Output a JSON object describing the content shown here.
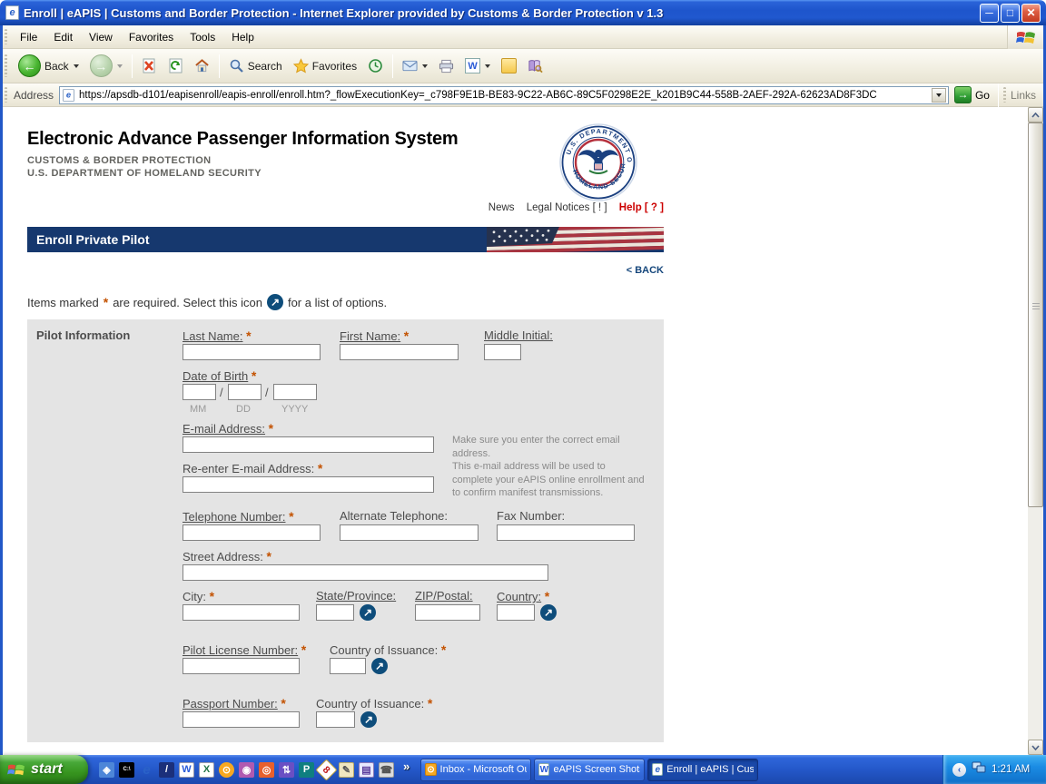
{
  "window": {
    "title": "Enroll | eAPIS | Customs and Border Protection - Internet Explorer provided by Customs & Border Protection v 1.3"
  },
  "menubar": {
    "items": [
      "File",
      "Edit",
      "View",
      "Favorites",
      "Tools",
      "Help"
    ]
  },
  "toolbar": {
    "back": "Back",
    "search": "Search",
    "favorites": "Favorites"
  },
  "addressbar": {
    "label": "Address",
    "url": "https://apsdb-d101/eapisenroll/eapis-enroll/enroll.htm?_flowExecutionKey=_c798F9E1B-BE83-9C22-AB6C-89C5F0298E2E_k201B9C44-558B-2AEF-292A-62623AD8F3DC",
    "go": "Go",
    "links": "Links"
  },
  "header": {
    "title": "Electronic Advance Passenger Information System",
    "line1": "CUSTOMS & BORDER PROTECTION",
    "line2": "U.S. DEPARTMENT OF HOMELAND SECURITY"
  },
  "utility": {
    "news": "News",
    "legal": "Legal Notices [ ! ]",
    "help": "Help [ ? ]"
  },
  "banner": {
    "title": "Enroll Private Pilot",
    "back": "< BACK"
  },
  "note": {
    "pre": "Items marked",
    "mid": "are required. Select this icon",
    "post": "for a list of options."
  },
  "icons": {
    "option_arrow": "↗"
  },
  "colors": {
    "banner_navy": "#16386e",
    "help_red": "#cc0000",
    "asterisk_orange": "#c35200",
    "back_link_blue": "#16477c"
  },
  "form": {
    "req": "*",
    "section": "Pilot Information",
    "last_name": "Last Name:",
    "first_name": "First Name:",
    "middle_initial": "Middle Initial:",
    "dob": "Date of Birth",
    "mm": "MM",
    "dd": "DD",
    "yyyy": "YYYY",
    "slash": "/",
    "email": "E-mail Address:",
    "email_note1": "Make sure you enter the correct email address.",
    "email_note2": "This e-mail address will be used to complete your eAPIS online enrollment and to confirm manifest transmissions.",
    "reenter_email": "Re-enter E-mail Address:",
    "telephone": "Telephone Number:",
    "alt_telephone": "Alternate Telephone:",
    "fax": "Fax Number:",
    "street": "Street Address:",
    "city": "City:",
    "state": "State/Province:",
    "zip": "ZIP/Postal:",
    "country": "Country:",
    "pilot_license": "Pilot License Number:",
    "license_country": "Country of Issuance:",
    "passport": "Passport Number:",
    "passport_country": "Country of Issuance:"
  },
  "taskbar": {
    "start": "start",
    "more": "»",
    "quick_launch": [
      {
        "name": "app",
        "glyph": "◈"
      },
      {
        "name": "command-prompt",
        "glyph": "C:\\"
      },
      {
        "name": "internet-explorer",
        "glyph": "e"
      },
      {
        "name": "slash-app",
        "glyph": "/"
      },
      {
        "name": "word",
        "glyph": "W"
      },
      {
        "name": "excel",
        "glyph": "X"
      },
      {
        "name": "clock-app",
        "glyph": "⊙"
      },
      {
        "name": "key-app",
        "glyph": "◉"
      },
      {
        "name": "orange-app",
        "glyph": "◎"
      },
      {
        "name": "sync-app",
        "glyph": "⇅"
      },
      {
        "name": "publisher",
        "glyph": "P"
      },
      {
        "name": "diamond-8",
        "glyph": "8"
      },
      {
        "name": "notes-app",
        "glyph": "✎"
      },
      {
        "name": "book-app",
        "glyph": "▤"
      },
      {
        "name": "phone-app",
        "glyph": "☎"
      }
    ],
    "tasks": [
      {
        "label": "Inbox - Microsoft Out..."
      },
      {
        "label": "eAPIS Screen Shots...."
      },
      {
        "label": "Enroll | eAPIS | Custo..."
      }
    ],
    "clock": "1:21 AM"
  }
}
